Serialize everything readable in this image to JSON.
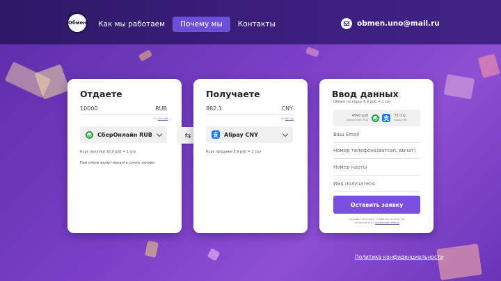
{
  "header": {
    "logo_text": "Обмен",
    "nav": [
      "Как мы работаем",
      "Почему мы",
      "Контакты"
    ],
    "nav_active_index": 1,
    "email": "obmen.uno@mail.ru"
  },
  "give": {
    "title": "Отдаете",
    "amount": "10000",
    "currency": "RUB",
    "min_prefix": "От",
    "min_value": "100 руб",
    "method": "СберОнлайн RUB",
    "method_icon": "sber-icon",
    "rate": "Курс покупки 10.9 руб = 1 cny",
    "note": "При смене валют введите сумму заново."
  },
  "swap_icon": "⇆",
  "receive": {
    "title": "Получаете",
    "amount": "882.1",
    "currency": "CNY",
    "min_prefix": "От",
    "min_value": "80 Cny",
    "method": "Alipay CNY",
    "method_icon": "alipay-icon",
    "rate": "Курс продажи 8.9 руб = 1 cny"
  },
  "form": {
    "title": "Ввод данных",
    "subtitle": "Обмен по курсу 8.9 руб = 1 cny",
    "summary": {
      "give_amount": "4990 руб",
      "give_method": "СберОнлайн RUB",
      "get_amount": "70 cny",
      "get_method": "Alipay CNY"
    },
    "fields": [
      "Ваш Email",
      "Номер телефона(ватсап, вичат)",
      "Номер карты",
      "Имя получателя"
    ],
    "submit": "Оставить заявку",
    "consent_prefix": "Нажимая на кнопку \"Перейти к оплате\" вы соглашаетесь с",
    "consent_link": "правилами обмена"
  },
  "footer": {
    "privacy": "Политика конфиденциальности"
  },
  "colors": {
    "accent": "#7b4fe0",
    "nav_active": "#6c4fd8",
    "header_bg": "#2e1866"
  }
}
